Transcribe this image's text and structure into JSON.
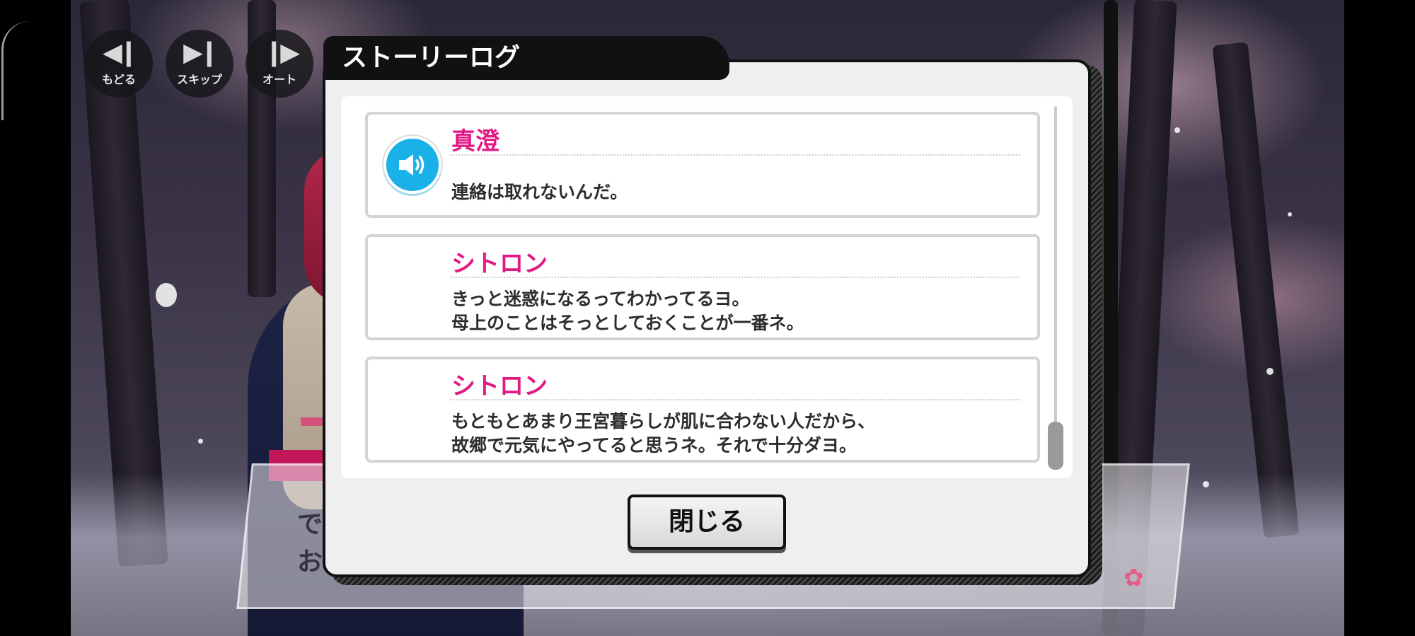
{
  "controls": {
    "back": "もどる",
    "skip": "スキップ",
    "auto": "オート"
  },
  "background": {
    "textbox_line1": "で",
    "textbox_line2": "お"
  },
  "modal": {
    "title": "ストーリーログ",
    "close_label": "閉じる"
  },
  "log": [
    {
      "speaker": "真澄",
      "lines": [
        "連絡は取れないんだ。"
      ],
      "has_voice": true
    },
    {
      "speaker": "シトロン",
      "lines": [
        "きっと迷惑になるってわかってるヨ。",
        "母上のことはそっとしておくことが一番ネ。"
      ],
      "has_voice": false
    },
    {
      "speaker": "シトロン",
      "lines": [
        "もともとあまり王宮暮らしが肌に合わない人だから、",
        "故郷で元気にやってると思うネ。それで十分ダヨ。"
      ],
      "has_voice": false
    }
  ],
  "icons": {
    "voice": "speaker-icon",
    "back": "rewind-icon",
    "skip": "skip-forward-icon",
    "auto": "play-auto-icon",
    "sakura": "sakura-flower-icon"
  },
  "colors": {
    "speaker_name": "#e01b84",
    "voice_button": "#1ab1e8"
  }
}
